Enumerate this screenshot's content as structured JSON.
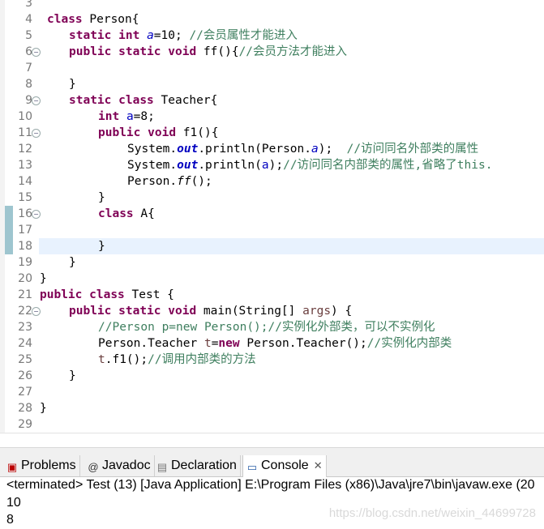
{
  "editor": {
    "line_numbers": [
      "3",
      "4",
      "5",
      "6",
      "7",
      "8",
      "9",
      "10",
      "11",
      "12",
      "13",
      "14",
      "15",
      "16",
      "17",
      "18",
      "19",
      "20",
      "21",
      "22",
      "23",
      "24",
      "25",
      "26",
      "27",
      "28",
      "29"
    ]
  },
  "tabs": [
    {
      "label": "Problems",
      "icon": "problems-icon"
    },
    {
      "label": "Javadoc",
      "icon": "javadoc-icon"
    },
    {
      "label": "Declaration",
      "icon": "declaration-icon"
    },
    {
      "label": "Console",
      "icon": "console-icon",
      "active": true
    }
  ],
  "console": {
    "status": "<terminated> Test (13) [Java Application] E:\\Program Files (x86)\\Java\\jre7\\bin\\javaw.exe (20",
    "output": [
      "10",
      "8"
    ],
    "watermark": "https://blog.csdn.net/weixin_44699728"
  },
  "code": {
    "l4": [
      "class",
      " Person{"
    ],
    "l5": [
      "static",
      "int",
      "a",
      "=10; ",
      "//会员属性才能进入"
    ],
    "l6": [
      "public",
      "static",
      "void",
      " ff(){",
      "//会员方法才能进入"
    ],
    "l8": "}",
    "l9": [
      "static",
      "class",
      " Teacher{"
    ],
    "l10": [
      "int",
      "a",
      "=8;"
    ],
    "l11": [
      "public",
      "void",
      " f1(){"
    ],
    "l12": [
      "System.",
      "out",
      ".println(Person.",
      "a",
      ");  ",
      "//访问同名外部类的属性"
    ],
    "l13": [
      "System.",
      "out",
      ".println(",
      "a",
      ");",
      "//访问同名内部类的属性,省略了this."
    ],
    "l14": [
      "Person.",
      "ff",
      "();"
    ],
    "l15": "}",
    "l16": [
      "class",
      " A{"
    ],
    "l18": "}",
    "l19": "}",
    "l20": "}",
    "l21": [
      "public",
      "class",
      " Test {"
    ],
    "l22": [
      "public",
      "static",
      "void",
      " main(String[] ",
      "args",
      ") {"
    ],
    "l23": "//Person p=new Person();//实例化外部类，可以不实例化",
    "l24": [
      "Person.Teacher ",
      "t",
      "=",
      "new",
      " Person.Teacher();",
      "//实例化内部类"
    ],
    "l25": [
      "t",
      ".f1();",
      "//调用内部类的方法"
    ],
    "l26": "}",
    "l28": "}"
  }
}
